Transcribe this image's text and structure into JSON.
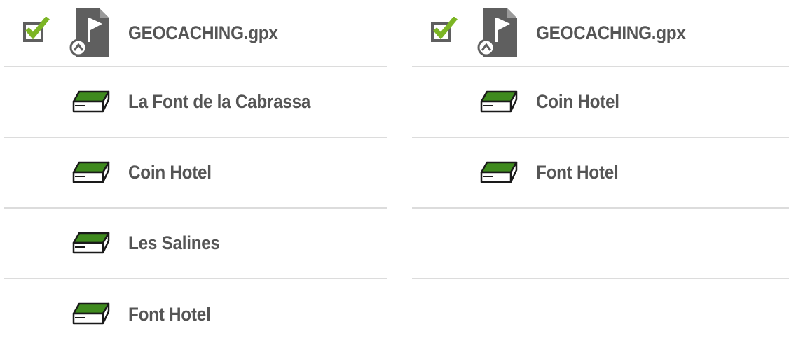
{
  "left_panel": {
    "file": {
      "label": "GEOCACHING.gpx",
      "checked": true,
      "icon": "gpx-file-flag-icon"
    },
    "items": [
      {
        "label": "La Font de la Cabrassa",
        "icon": "geocache-box-icon"
      },
      {
        "label": "Coin Hotel",
        "icon": "geocache-box-icon"
      },
      {
        "label": "Les Salines",
        "icon": "geocache-box-icon"
      },
      {
        "label": "Font Hotel",
        "icon": "geocache-box-icon"
      }
    ]
  },
  "right_panel": {
    "file": {
      "label": "GEOCACHING.gpx",
      "checked": true,
      "icon": "gpx-file-flag-icon"
    },
    "items": [
      {
        "label": "Coin Hotel",
        "icon": "geocache-box-icon"
      },
      {
        "label": "Font Hotel",
        "icon": "geocache-box-icon"
      }
    ]
  },
  "colors": {
    "text": "#555555",
    "divider": "#dcdcdc",
    "check_green": "#7cb524",
    "icon_gray": "#5f5f5f",
    "cache_green": "#3f8a1e"
  }
}
